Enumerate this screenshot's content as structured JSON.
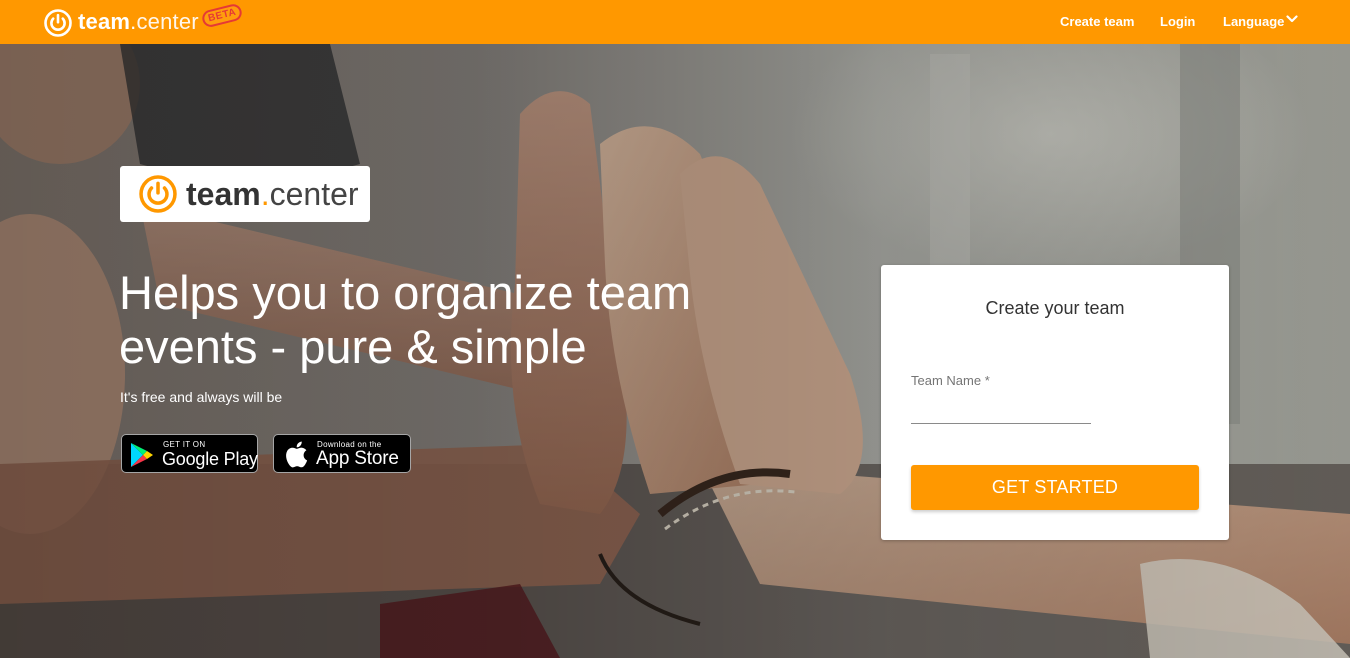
{
  "header": {
    "brand": {
      "part1": "team",
      "part2": ".",
      "part3": "center",
      "badge": "BETA"
    },
    "nav": {
      "create_team": "Create team",
      "login": "Login",
      "language": "Language"
    }
  },
  "hero": {
    "logo": {
      "part1": "team",
      "part2": ".",
      "part3": "center"
    },
    "headline": "Helps you to organize team events - pure & simple",
    "tagline": "It's free and always will be",
    "google_play": {
      "small": "GET IT ON",
      "big": "Google Play"
    },
    "app_store": {
      "small": "Download on the",
      "big": "App Store"
    }
  },
  "signup_card": {
    "title": "Create your team",
    "team_name_label": "Team Name *",
    "team_name_value": "",
    "submit_label": "GET STARTED"
  },
  "colors": {
    "brand_orange": "#ff9800",
    "beta_red": "#e53935",
    "white": "#ffffff"
  },
  "icons": {
    "brand": "power-icon",
    "language_toggle": "chevron-down-icon",
    "google_play": "google-play-icon",
    "app_store": "apple-icon"
  }
}
